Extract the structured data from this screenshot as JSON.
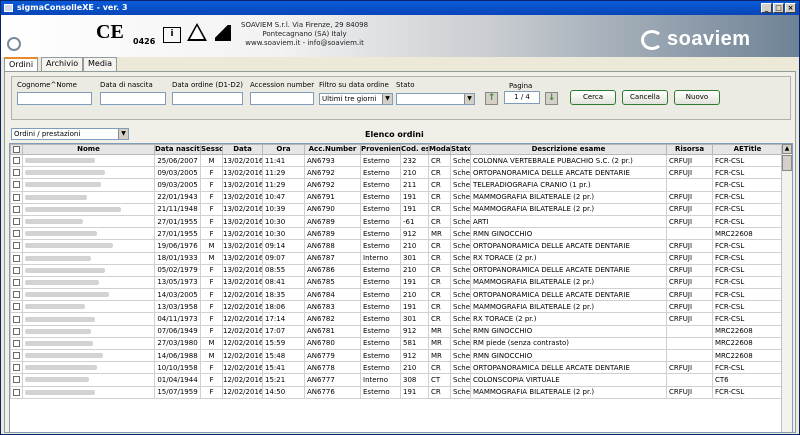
{
  "window": {
    "title": "sigmaConsolleXE - ver. 3"
  },
  "header": {
    "ce_mark": "CE",
    "ce_number": "0426",
    "book_icon_text": "i",
    "company_line1": "SOAVIEM S.r.l. Via Firenze, 29 84098",
    "company_line2": "Pontecagnano (SA) Italy",
    "company_line3": "www.soaviem.it - info@soaviem.it",
    "brand": "soaviem"
  },
  "tabs": [
    {
      "label": "Ordini"
    },
    {
      "label": "Archivio"
    },
    {
      "label": "Media"
    }
  ],
  "filters": {
    "labels": {
      "patient": "Cognome^Nome",
      "birth": "Data di nascita",
      "order_date": "Data ordine (D1-D2)",
      "accession": "Accession number",
      "date_filter": "Filtro su data ordine",
      "status": "Stato",
      "page": "Pagina"
    },
    "date_filter_value": "Ultimi tre giorni",
    "status_value": "",
    "page_value": "1 / 4",
    "buttons": {
      "search": "Cerca",
      "cancel": "Cancella",
      "new": "Nuovo"
    }
  },
  "list": {
    "selector_value": "Ordini / prestazioni",
    "title": "Elenco ordini",
    "columns": [
      "",
      "Nome",
      "Data nascita",
      "Sesso",
      "Data",
      "Ora",
      "Acc.Number",
      "Provenienza",
      "Cod. esame",
      "Modality",
      "Stato",
      "Descrizione esame",
      "Risorsa",
      "AETitle"
    ],
    "rows": [
      {
        "dob": "25/06/2007",
        "sex": "M",
        "date": "13/02/2016",
        "time": "11:41",
        "acc": "AN6793",
        "prov": "Esterno",
        "code": "232",
        "mod": "CR",
        "state": "Schedul",
        "desc": "COLONNA VERTEBRALE PUBACHIO S.C. (2 pr.)",
        "res": "CRFUJI",
        "ae": "FCR-CSL"
      },
      {
        "dob": "09/03/2005",
        "sex": "F",
        "date": "13/02/2016",
        "time": "11:29",
        "acc": "AN6792",
        "prov": "Esterno",
        "code": "210",
        "mod": "CR",
        "state": "Schedul",
        "desc": "ORTOPANORAMICA DELLE ARCATE DENTARIE",
        "res": "CRFUJI",
        "ae": "FCR-CSL"
      },
      {
        "dob": "09/03/2005",
        "sex": "F",
        "date": "13/02/2016",
        "time": "11:29",
        "acc": "AN6792",
        "prov": "Esterno",
        "code": "211",
        "mod": "CR",
        "state": "Schedul",
        "desc": "TELERADIOGRAFIA CRANIO (1 pr.)",
        "res": "",
        "ae": "FCR-CSL"
      },
      {
        "dob": "22/01/1943",
        "sex": "F",
        "date": "13/02/2016",
        "time": "10:47",
        "acc": "AN6791",
        "prov": "Esterno",
        "code": "191",
        "mod": "CR",
        "state": "Schedul",
        "desc": "MAMMOGRAFIA BILATERALE (2 pr.)",
        "res": "CRFUJI",
        "ae": "FCR-CSL"
      },
      {
        "dob": "21/11/1948",
        "sex": "F",
        "date": "13/02/2016",
        "time": "10:39",
        "acc": "AN6790",
        "prov": "Esterno",
        "code": "191",
        "mod": "CR",
        "state": "Schedul",
        "desc": "MAMMOGRAFIA BILATERALE (2 pr.)",
        "res": "CRFUJI",
        "ae": "FCR-CSL"
      },
      {
        "dob": "27/01/1955",
        "sex": "F",
        "date": "13/02/2016",
        "time": "10:30",
        "acc": "AN6789",
        "prov": "Esterno",
        "code": "-61",
        "mod": "CR",
        "state": "Schedul",
        "desc": "ARTI",
        "res": "CRFUJI",
        "ae": "FCR-CSL"
      },
      {
        "dob": "27/01/1955",
        "sex": "F",
        "date": "13/02/2016",
        "time": "10:30",
        "acc": "AN6789",
        "prov": "Esterno",
        "code": "912",
        "mod": "MR",
        "state": "Schedul",
        "desc": "RMN GINOCCHIO",
        "res": "",
        "ae": "MRC22608"
      },
      {
        "dob": "19/06/1976",
        "sex": "M",
        "date": "13/02/2016",
        "time": "09:14",
        "acc": "AN6788",
        "prov": "Esterno",
        "code": "210",
        "mod": "CR",
        "state": "Schedul",
        "desc": "ORTOPANORAMICA DELLE ARCATE DENTARIE",
        "res": "CRFUJI",
        "ae": "FCR-CSL"
      },
      {
        "dob": "18/01/1933",
        "sex": "M",
        "date": "13/02/2016",
        "time": "09:07",
        "acc": "AN6787",
        "prov": "Interno",
        "code": "301",
        "mod": "CR",
        "state": "Schedul",
        "desc": "RX TORACE (2 pr.)",
        "res": "CRFUJI",
        "ae": "FCR-CSL"
      },
      {
        "dob": "05/02/1979",
        "sex": "F",
        "date": "13/02/2016",
        "time": "08:55",
        "acc": "AN6786",
        "prov": "Esterno",
        "code": "210",
        "mod": "CR",
        "state": "Schedul",
        "desc": "ORTOPANORAMICA DELLE ARCATE DENTARIE",
        "res": "CRFUJI",
        "ae": "FCR-CSL"
      },
      {
        "dob": "13/05/1973",
        "sex": "F",
        "date": "13/02/2016",
        "time": "08:41",
        "acc": "AN6785",
        "prov": "Esterno",
        "code": "191",
        "mod": "CR",
        "state": "Schedul",
        "desc": "MAMMOGRAFIA BILATERALE (2 pr.)",
        "res": "CRFUJI",
        "ae": "FCR-CSL"
      },
      {
        "dob": "14/03/2005",
        "sex": "F",
        "date": "12/02/2016",
        "time": "18:35",
        "acc": "AN6784",
        "prov": "Esterno",
        "code": "210",
        "mod": "CR",
        "state": "Schedul",
        "desc": "ORTOPANORAMICA DELLE ARCATE DENTARIE",
        "res": "CRFUJI",
        "ae": "FCR-CSL"
      },
      {
        "dob": "13/03/1958",
        "sex": "F",
        "date": "12/02/2016",
        "time": "18:06",
        "acc": "AN6783",
        "prov": "Esterno",
        "code": "191",
        "mod": "CR",
        "state": "Schedul",
        "desc": "MAMMOGRAFIA BILATERALE (2 pr.)",
        "res": "CRFUJI",
        "ae": "FCR-CSL"
      },
      {
        "dob": "04/11/1973",
        "sex": "F",
        "date": "12/02/2016",
        "time": "17:14",
        "acc": "AN6782",
        "prov": "Esterno",
        "code": "301",
        "mod": "CR",
        "state": "Schedul",
        "desc": "RX TORACE (2 pr.)",
        "res": "CRFUJI",
        "ae": "FCR-CSL"
      },
      {
        "dob": "07/06/1949",
        "sex": "F",
        "date": "12/02/2016",
        "time": "17:07",
        "acc": "AN6781",
        "prov": "Esterno",
        "code": "912",
        "mod": "MR",
        "state": "Schedul",
        "desc": "RMN GINOCCHIO",
        "res": "",
        "ae": "MRC22608"
      },
      {
        "dob": "27/03/1980",
        "sex": "M",
        "date": "12/02/2016",
        "time": "15:59",
        "acc": "AN6780",
        "prov": "Esterno",
        "code": "581",
        "mod": "MR",
        "state": "Schedul",
        "desc": "RM piede (senza contrasto)",
        "res": "",
        "ae": "MRC22608"
      },
      {
        "dob": "14/06/1988",
        "sex": "M",
        "date": "12/02/2016",
        "time": "15:48",
        "acc": "AN6779",
        "prov": "Esterno",
        "code": "912",
        "mod": "MR",
        "state": "Schedul",
        "desc": "RMN GINOCCHIO",
        "res": "",
        "ae": "MRC22608"
      },
      {
        "dob": "10/10/1958",
        "sex": "F",
        "date": "12/02/2016",
        "time": "15:41",
        "acc": "AN6778",
        "prov": "Esterno",
        "code": "210",
        "mod": "CR",
        "state": "Schedul",
        "desc": "ORTOPANORAMICA DELLE ARCATE DENTARIE",
        "res": "CRFUJI",
        "ae": "FCR-CSL"
      },
      {
        "dob": "01/04/1944",
        "sex": "F",
        "date": "12/02/2016",
        "time": "15:21",
        "acc": "AN6777",
        "prov": "Interno",
        "code": "308",
        "mod": "CT",
        "state": "Schedul",
        "desc": "COLONSCOPIA VIRTUALE",
        "res": "",
        "ae": "CT6"
      },
      {
        "dob": "15/07/1959",
        "sex": "F",
        "date": "12/02/2016",
        "time": "14:50",
        "acc": "AN6776",
        "prov": "Esterno",
        "code": "191",
        "mod": "CR",
        "state": "Schedul",
        "desc": "MAMMOGRAFIA BILATERALE (2 pr.)",
        "res": "CRFUJI",
        "ae": "FCR-CSL"
      }
    ]
  }
}
